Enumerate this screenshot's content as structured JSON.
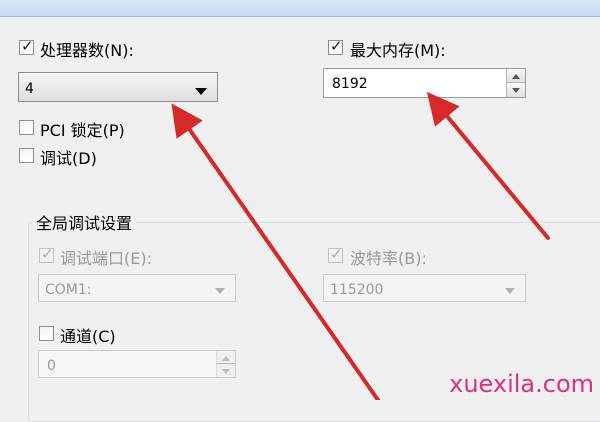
{
  "window": {
    "title": ""
  },
  "processors": {
    "label": "处理器数(N):",
    "checked": true,
    "value": "4"
  },
  "max_memory": {
    "label": "最大内存(M):",
    "checked": true,
    "value": "8192"
  },
  "pci_lock": {
    "label": "PCI 锁定(P)",
    "checked": false
  },
  "debug": {
    "label": "调试(D)",
    "checked": false
  },
  "global_debug": {
    "title": "全局调试设置",
    "debug_port": {
      "label": "调试端口(E):",
      "checked": true,
      "value": "COM1:"
    },
    "baud_rate": {
      "label": "波特率(B):",
      "checked": true,
      "value": "115200"
    },
    "channel": {
      "label": "通道(C)",
      "checked": false,
      "value": "0"
    }
  },
  "watermark": "xuexila.com",
  "colors": {
    "arrow": "#d62a2a",
    "watermark": "#e0307a",
    "dialog_bg": "#f0f0f0"
  }
}
